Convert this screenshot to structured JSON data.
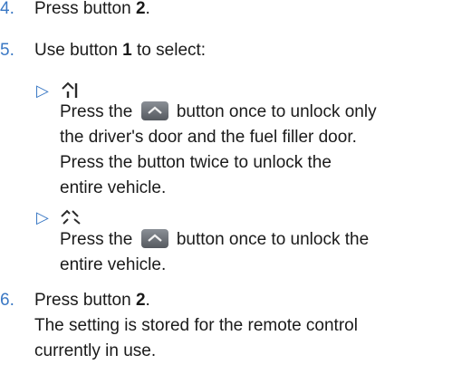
{
  "steps": [
    {
      "number": "4.",
      "prefix": "Press button ",
      "bold": "2",
      "suffix": "."
    },
    {
      "number": "5.",
      "prefix": "Use button ",
      "bold": "1",
      "suffix": " to select:"
    },
    {
      "number": "6.",
      "prefix": "Press button ",
      "bold": "2",
      "suffix": ".",
      "detail": [
        "The setting is stored for the remote control",
        "currently in use."
      ]
    }
  ],
  "options": [
    {
      "arrow": "▷",
      "icon": "single-door-unlock-icon",
      "line1_prefix": "Press the ",
      "line1_suffix": " button once to unlock only",
      "lines": [
        "the driver's door and the fuel filler door.",
        "Press the button twice to unlock the",
        "entire vehicle."
      ]
    },
    {
      "arrow": "▷",
      "icon": "all-doors-unlock-icon",
      "line1_prefix": "Press the ",
      "line1_suffix": " button once to unlock the",
      "lines": [
        "entire vehicle."
      ]
    }
  ],
  "colors": {
    "number": "#3a78c4",
    "text": "#1a1a1a",
    "key_button": "#6e7379"
  }
}
